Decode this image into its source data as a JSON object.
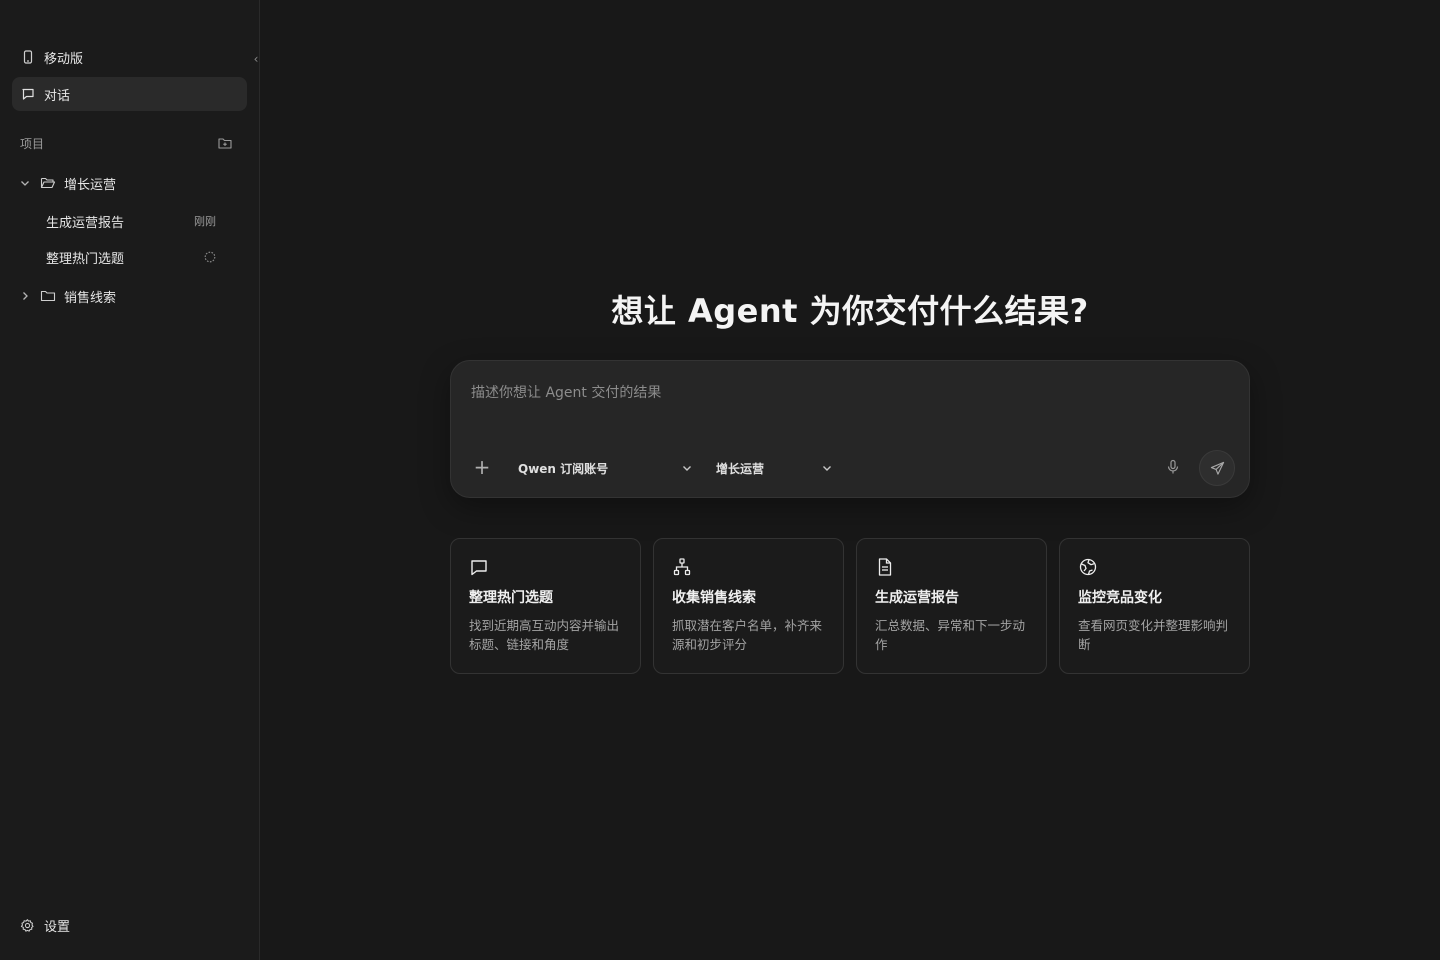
{
  "sidebar": {
    "mobile_label": "移动版",
    "chat_label": "对话",
    "projects_label": "项目",
    "projects": [
      {
        "name": "增长运营",
        "expanded": true,
        "tasks": [
          {
            "name": "生成运营报告",
            "meta": "刚刚"
          },
          {
            "name": "整理热门选题",
            "status": "running"
          }
        ]
      },
      {
        "name": "销售线索",
        "expanded": false
      }
    ],
    "settings_label": "设置"
  },
  "main": {
    "headline": "想让 Agent 为你交付什么结果?",
    "composer": {
      "placeholder": "描述你想让 Agent 交付的结果",
      "model_select": "Qwen 订阅账号",
      "project_select": "增长运营"
    },
    "cards": [
      {
        "icon": "message-square-icon",
        "title": "整理热门选题",
        "desc": "找到近期高互动内容并输出标题、链接和角度"
      },
      {
        "icon": "network-icon",
        "title": "收集销售线索",
        "desc": "抓取潜在客户名单，补齐来源和初步评分"
      },
      {
        "icon": "file-text-icon",
        "title": "生成运营报告",
        "desc": "汇总数据、异常和下一步动作"
      },
      {
        "icon": "globe-icon",
        "title": "监控竞品变化",
        "desc": "查看网页变化并整理影响判断"
      }
    ]
  }
}
